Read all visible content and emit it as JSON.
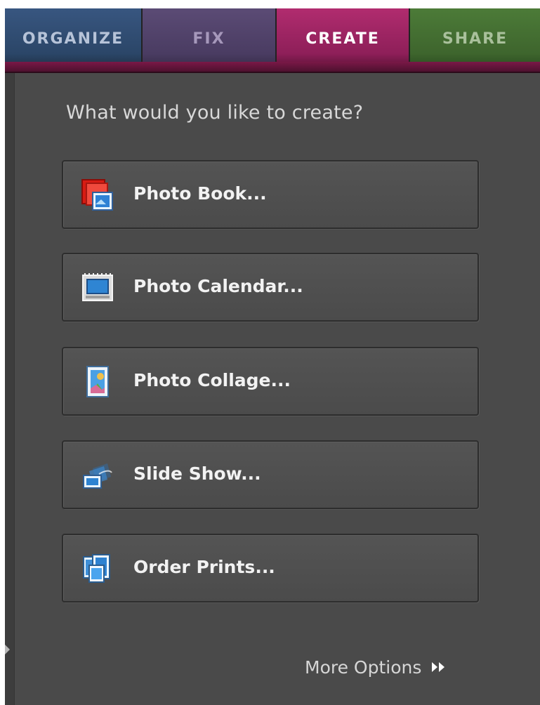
{
  "tabs": [
    {
      "label": "ORGANIZE",
      "active": false
    },
    {
      "label": "FIX",
      "active": false
    },
    {
      "label": "CREATE",
      "active": true
    },
    {
      "label": "SHARE",
      "active": false
    }
  ],
  "create_panel": {
    "prompt": "What would you like to create?",
    "options": [
      {
        "label": "Photo Book...",
        "icon": "photo-book-icon"
      },
      {
        "label": "Photo Calendar...",
        "icon": "photo-calendar-icon"
      },
      {
        "label": "Photo Collage...",
        "icon": "photo-collage-icon"
      },
      {
        "label": "Slide Show...",
        "icon": "slide-show-icon"
      },
      {
        "label": "Order Prints...",
        "icon": "order-prints-icon"
      }
    ],
    "more_options": {
      "label": "More Options",
      "icon": "double-chevron-right-icon"
    }
  },
  "colors": {
    "panel_background": "#4a4a4a",
    "organize_tab": "#2b4668",
    "fix_tab": "#4a3c62",
    "create_tab": "#8e1f59",
    "share_tab": "#3e652d"
  }
}
